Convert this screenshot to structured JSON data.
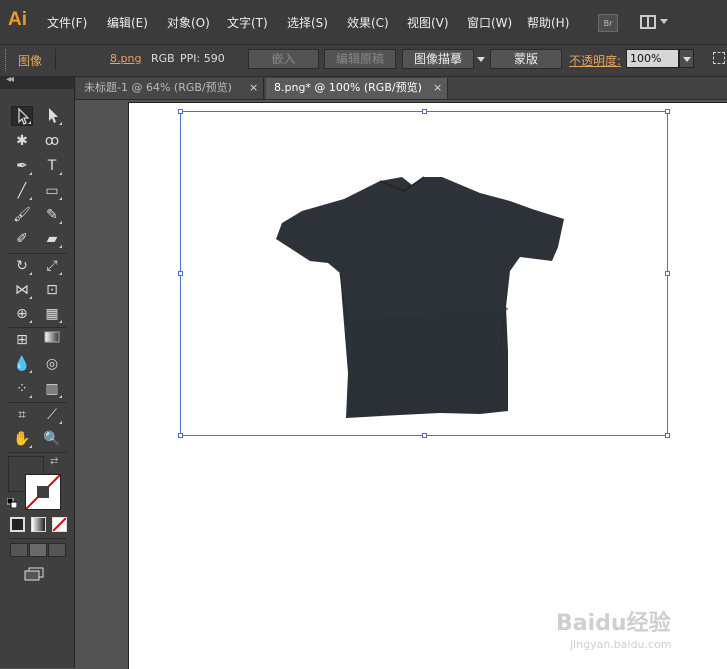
{
  "app": {
    "logo": "Ai"
  },
  "menu": [
    "文件(F)",
    "编辑(E)",
    "对象(O)",
    "文字(T)",
    "选择(S)",
    "效果(C)",
    "视图(V)",
    "窗口(W)",
    "帮助(H)"
  ],
  "bridge_label": "Br",
  "control_bar": {
    "object_type": "图像",
    "filename": "8.png",
    "color_mode": "RGB",
    "ppi": "PPI: 590",
    "embed": "嵌入",
    "edit_original": "编辑原稿",
    "image_trace": "图像描摹",
    "mask": "蒙版",
    "opacity_label": "不透明度:",
    "opacity_value": "100%"
  },
  "tabs": [
    {
      "label": "未标题-1 @ 64% (RGB/预览)",
      "close": "×"
    },
    {
      "label": "8.png* @ 100% (RGB/预览)",
      "close": "×"
    }
  ],
  "tool_panel": {
    "collapse": "◂◂"
  },
  "watermark": {
    "brand": "Baidu经验",
    "url": "jingyan.baidu.com"
  },
  "colors": {
    "accent": "#e89b2f",
    "selection": "#4a6fd1",
    "shirt": "#2b3137"
  }
}
